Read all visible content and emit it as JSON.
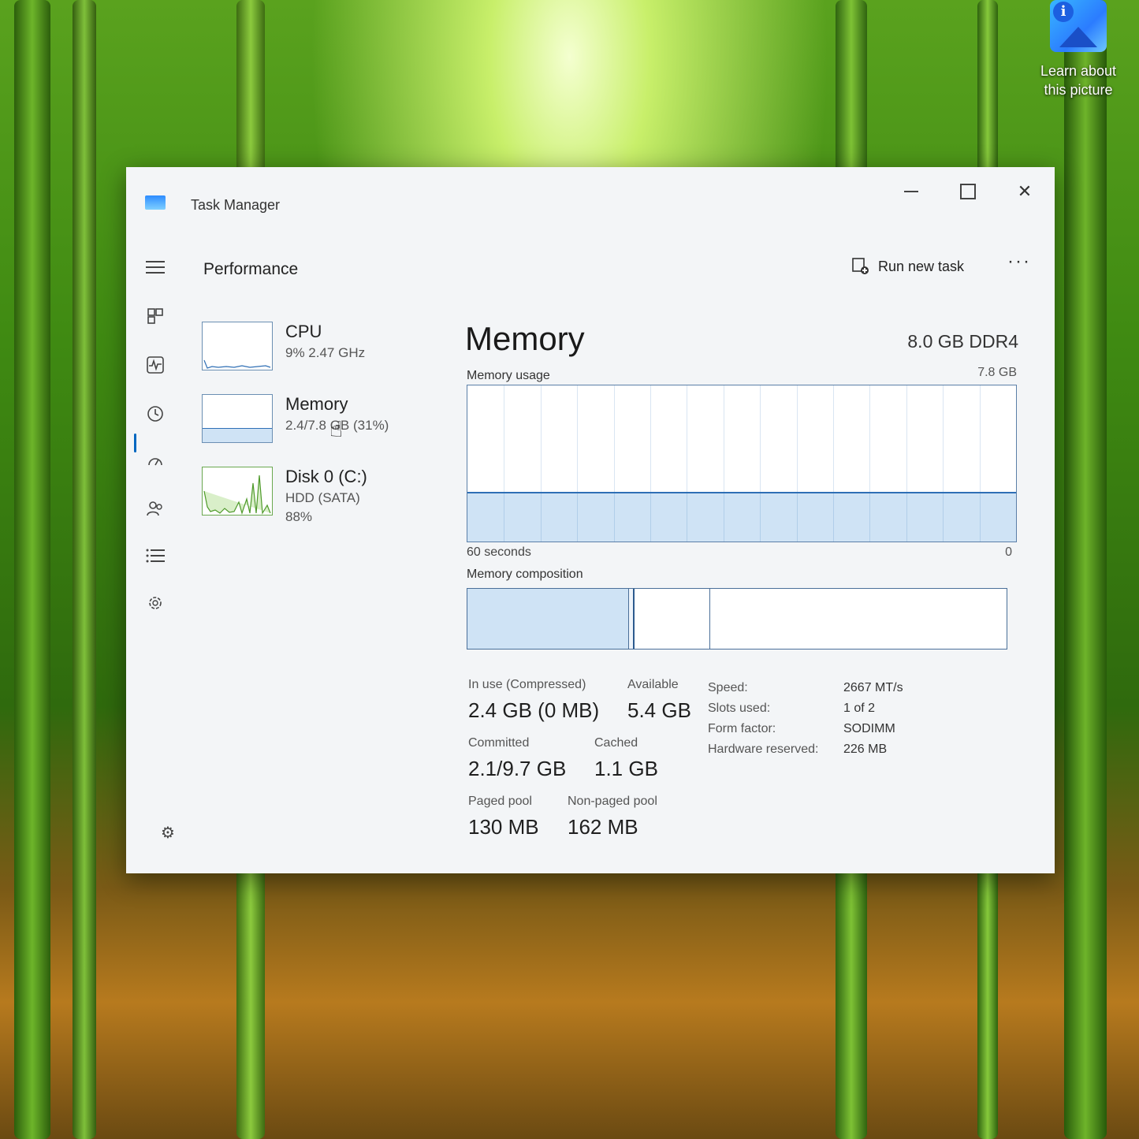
{
  "desktop": {
    "icon_label_line1": "Learn about",
    "icon_label_line2": "this picture",
    "icon_name": "info-picture-icon"
  },
  "window": {
    "title": "Task Manager",
    "page_title": "Performance",
    "run_task_label": "Run new task",
    "more_label": "···"
  },
  "sidebar": {
    "items": [
      {
        "name": "CPU",
        "sub": "9%  2.47 GHz"
      },
      {
        "name": "Memory",
        "sub": "2.4/7.8 GB (31%)"
      },
      {
        "name": "Disk 0 (C:)",
        "sub": "HDD (SATA)",
        "sub2": "88%"
      }
    ]
  },
  "memory": {
    "title": "Memory",
    "spec": "8.0 GB DDR4",
    "usage_label": "Memory usage",
    "usage_max": "7.8 GB",
    "usage_fraction": 0.31,
    "axis_left": "60 seconds",
    "axis_right": "0",
    "composition_label": "Memory composition",
    "composition": {
      "in_use": 0.3,
      "modified": 0.01,
      "standby": 0.14
    },
    "stats": {
      "in_use_label": "In use (Compressed)",
      "in_use_value": "2.4 GB (0 MB)",
      "available_label": "Available",
      "available_value": "5.4 GB",
      "committed_label": "Committed",
      "committed_value": "2.1/9.7 GB",
      "cached_label": "Cached",
      "cached_value": "1.1 GB",
      "paged_label": "Paged pool",
      "paged_value": "130 MB",
      "nonpaged_label": "Non-paged pool",
      "nonpaged_value": "162 MB"
    },
    "details": [
      {
        "label": "Speed:",
        "value": "2667 MT/s"
      },
      {
        "label": "Slots used:",
        "value": "1 of 2"
      },
      {
        "label": "Form factor:",
        "value": "SODIMM"
      },
      {
        "label": "Hardware reserved:",
        "value": "226 MB"
      }
    ]
  },
  "colors": {
    "accent": "#0067c0",
    "graph_line": "#2f6fb5",
    "graph_fill": "#cfe3f5"
  }
}
